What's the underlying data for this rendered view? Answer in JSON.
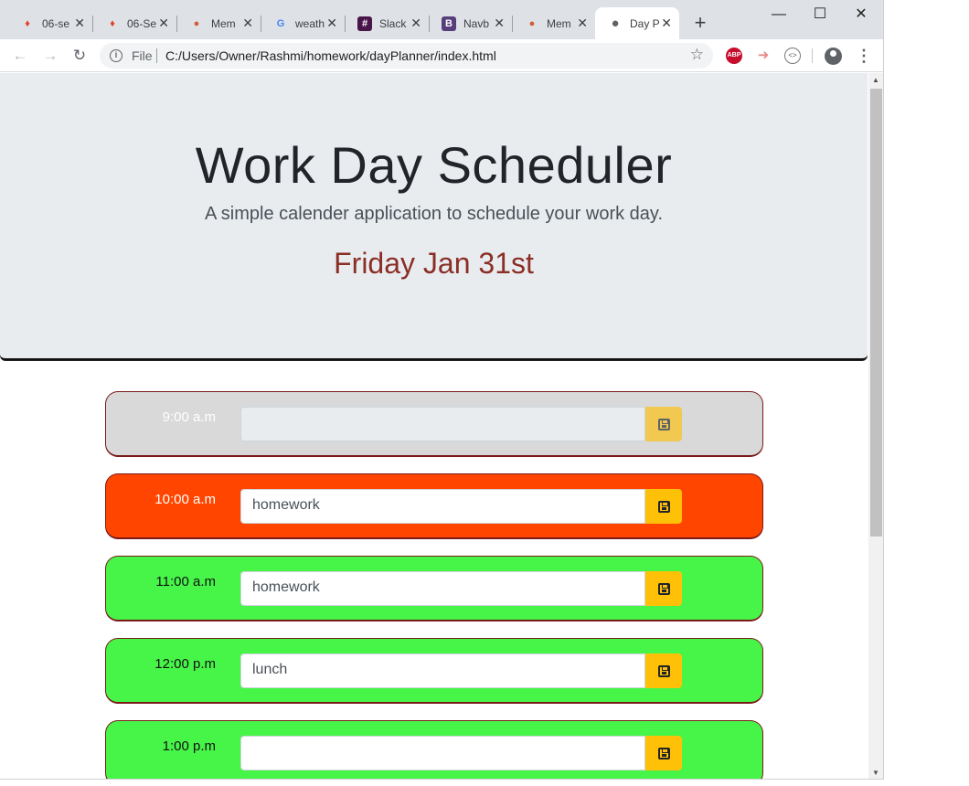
{
  "browser": {
    "tabs": [
      {
        "label": "06-se",
        "icon": "gitlab-icon"
      },
      {
        "label": "06-Se",
        "icon": "gitlab-icon"
      },
      {
        "label": "Mem",
        "icon": "helmet-icon"
      },
      {
        "label": "weath",
        "icon": "google-icon"
      },
      {
        "label": "Slack",
        "icon": "slack-icon"
      },
      {
        "label": "Navb",
        "icon": "bootstrap-icon"
      },
      {
        "label": "Mem",
        "icon": "helmet-icon"
      },
      {
        "label": "Day P",
        "icon": "globe-icon",
        "active": true
      }
    ],
    "address": {
      "scheme_label": "File",
      "url": "C:/Users/Owner/Rashmi/homework/dayPlanner/index.html"
    },
    "extensions": [
      {
        "name": "adblock-plus-icon",
        "label": "ABP"
      },
      {
        "name": "arrow-extension-icon"
      },
      {
        "name": "code-extension-icon"
      }
    ]
  },
  "page": {
    "title": "Work Day Scheduler",
    "lead": "A simple calender application to schedule your work day.",
    "current_day": "Friday Jan 31st",
    "rows": [
      {
        "hour": "9:00 a.m",
        "value": "",
        "state": "past"
      },
      {
        "hour": "10:00 a.m",
        "value": "homework",
        "state": "present"
      },
      {
        "hour": "11:00 a.m",
        "value": "homework",
        "state": "future"
      },
      {
        "hour": "12:00 p.m",
        "value": "lunch",
        "state": "future"
      },
      {
        "hour": "1:00 p.m",
        "value": "",
        "state": "future"
      }
    ]
  },
  "colors": {
    "past": "#d9d9d9",
    "present": "#ff4500",
    "future": "#47f549",
    "save_button": "#ffc107",
    "current_day": "#8b2e26"
  }
}
